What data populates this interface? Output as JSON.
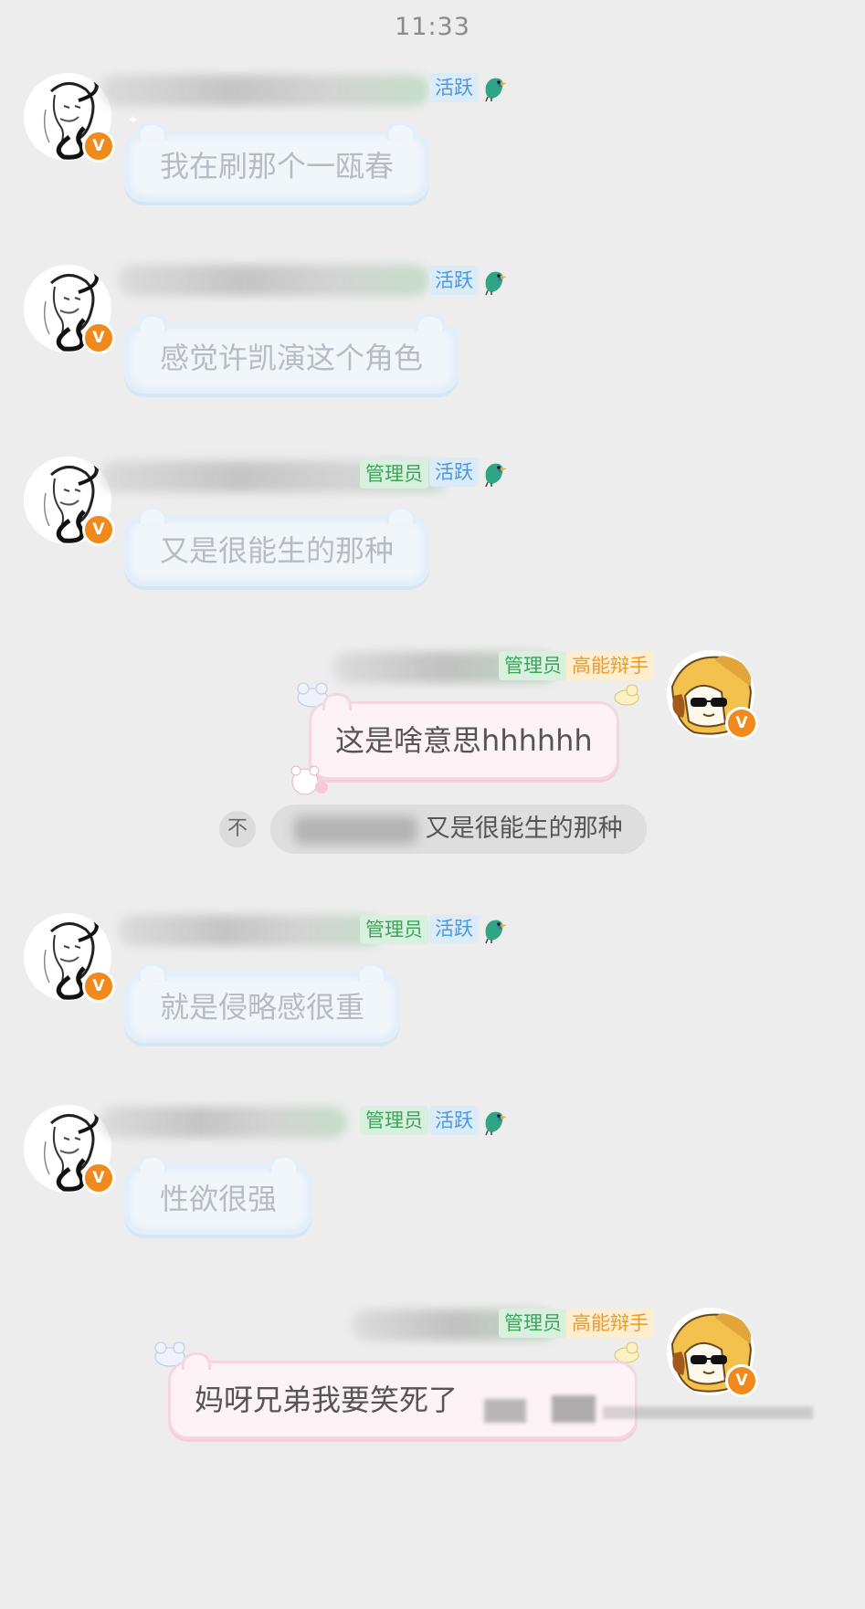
{
  "status_bar": {
    "time": "11:33"
  },
  "tags": {
    "active": "活跃",
    "admin": "管理员",
    "debater": "高能辩手"
  },
  "messages": [
    {
      "side": "left",
      "text": "我在刷那个一瓯春",
      "tags": [
        "活跃"
      ]
    },
    {
      "side": "left",
      "text": "感觉许凯演这个角色",
      "tags": [
        "活跃"
      ]
    },
    {
      "side": "left",
      "text": "又是很能生的那种",
      "tags": [
        "管理员",
        "活跃"
      ]
    },
    {
      "side": "right",
      "text": "这是啥意思hhhhhh",
      "tags": [
        "管理员",
        "高能辩手"
      ],
      "quote": {
        "icon": "不",
        "text": "又是很能生的那种"
      }
    },
    {
      "side": "left",
      "text": "就是侵略感很重",
      "tags": [
        "管理员",
        "活跃"
      ]
    },
    {
      "side": "left",
      "text": "性欲很强",
      "tags": [
        "管理员",
        "活跃"
      ]
    },
    {
      "side": "right",
      "text": "妈呀兄弟我要笑死了",
      "tags": [
        "管理员",
        "高能辩手"
      ]
    }
  ],
  "badges": {
    "verified": "V"
  },
  "colors": {
    "background": "#ededed",
    "active_tag": "#4a98e0",
    "admin_tag": "#3aa55a",
    "debater_tag": "#e99b2b",
    "verified_badge": "#f08a1c"
  },
  "icons": {
    "left_avatar": "sketch-character-avatar",
    "right_avatar": "dog-with-sunglasses-avatar",
    "bird": "bird-icon"
  }
}
